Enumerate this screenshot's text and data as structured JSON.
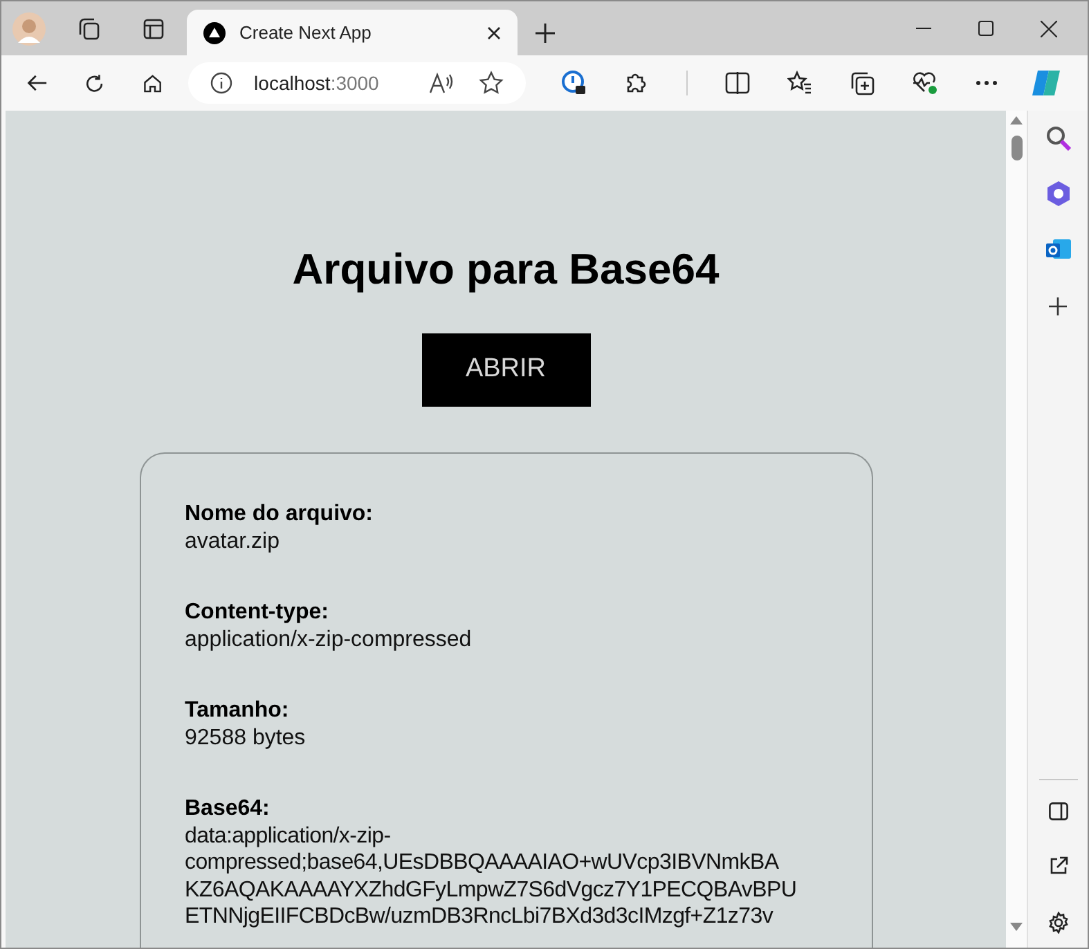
{
  "browser": {
    "tab": {
      "title": "Create Next App",
      "selected": true
    },
    "address": {
      "host": "localhost",
      "port": ":3000"
    }
  },
  "page": {
    "title": "Arquivo para Base64",
    "button": "ABRIR",
    "fields": [
      {
        "kind": "text",
        "label": "Nome do arquivo:",
        "value": "avatar.zip"
      },
      {
        "kind": "text",
        "label": "Content-type:",
        "value": "application/x-zip-compressed"
      },
      {
        "kind": "text",
        "label": "Tamanho:",
        "value": "92588 bytes"
      },
      {
        "kind": "lines",
        "label": "Base64:",
        "lines": [
          "data:application/x-zip-",
          "compressed;base64,UEsDBBQAAAAIAO+wUVcp3IBVNmkBA",
          "KZ6AQAKAAAAYXZhdGFyLmpwZ7S6dVgcz7Y1PECQBAvBPU",
          "ETNNjgEIIFCBDcBw/uzmDB3RncLbi7BXd3d3cIMzgf+Z1z73v"
        ]
      }
    ]
  }
}
